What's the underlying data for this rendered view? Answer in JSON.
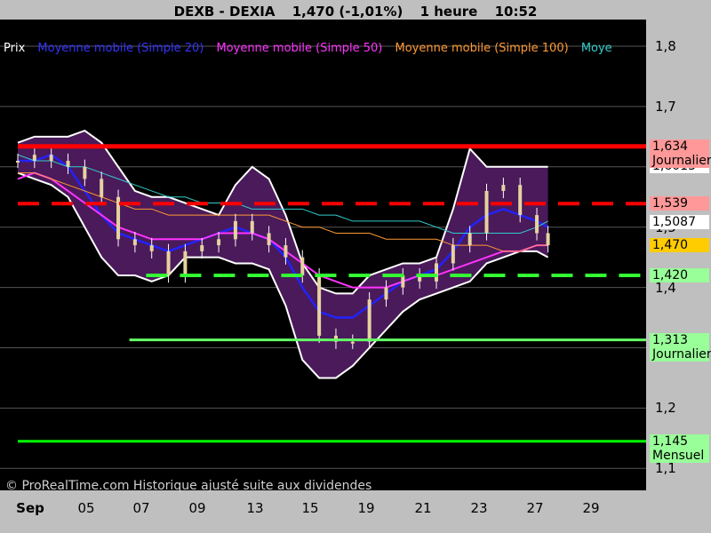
{
  "header": {
    "symbol": "DEXB - DEXIA",
    "quote": "1,470 (-1,01%)",
    "interval": "1 heure",
    "time": "10:52"
  },
  "legend": [
    {
      "label": "Prix",
      "color": "#ffffff"
    },
    {
      "label": "Moyenne mobile (Simple 20)",
      "color": "#3333ff"
    },
    {
      "label": "Moyenne mobile (Simple 50)",
      "color": "#ff33ff"
    },
    {
      "label": "Moyenne mobile (Simple 100)",
      "color": "#ff9933"
    },
    {
      "label": "Moye",
      "color": "#33cccc"
    }
  ],
  "copyright": "© ProRealTime.com Historique ajusté suite aux dividendes",
  "colors": {
    "background": "#000000",
    "band_fill": "#4a1a5a",
    "band_edge": "#ffffff",
    "ma20": "#2222ff",
    "ma50": "#ff33ff",
    "ma100": "#ff9933",
    "ma200": "#33cccc",
    "resistance": "#ff0000",
    "support": "#33ff33"
  },
  "chart_data": {
    "type": "candlestick",
    "title": "DEXB - DEXIA 1,470 (-1,01%) 1 heure 10:52",
    "x_axis": {
      "unit": "day of September",
      "ticks": [
        "Sep",
        "05",
        "07",
        "09",
        "13",
        "15",
        "19",
        "21",
        "23",
        "27",
        "29"
      ],
      "range": [
        1,
        30
      ]
    },
    "y_axis": {
      "ticks": [
        "1,8",
        "1,7",
        "1,6",
        "1,5",
        "1,4",
        "1,3",
        "1,2",
        "1,1"
      ],
      "range": [
        1.08,
        1.85
      ]
    },
    "price_series": {
      "name": "Prix",
      "x": [
        1.0,
        1.6,
        2.2,
        2.8,
        3.4,
        4.0,
        4.6,
        5.2,
        5.8,
        6.4,
        7.0,
        7.6,
        8.2,
        8.8,
        9.4,
        10.0,
        10.6,
        11.2,
        11.8,
        12.4,
        13.0,
        13.6,
        14.2,
        14.8,
        15.4,
        16.0,
        16.6,
        17.2,
        17.8,
        18.4,
        19.0,
        19.6,
        20.0
      ],
      "close": [
        1.61,
        1.62,
        1.61,
        1.6,
        1.58,
        1.55,
        1.48,
        1.47,
        1.46,
        1.42,
        1.46,
        1.47,
        1.48,
        1.51,
        1.49,
        1.47,
        1.45,
        1.42,
        1.32,
        1.31,
        1.31,
        1.38,
        1.4,
        1.42,
        1.41,
        1.44,
        1.47,
        1.49,
        1.56,
        1.57,
        1.52,
        1.49,
        1.47
      ]
    },
    "bollinger": {
      "upper": [
        1.64,
        1.65,
        1.65,
        1.65,
        1.66,
        1.64,
        1.6,
        1.56,
        1.55,
        1.55,
        1.54,
        1.53,
        1.52,
        1.57,
        1.6,
        1.58,
        1.52,
        1.44,
        1.4,
        1.39,
        1.39,
        1.42,
        1.43,
        1.44,
        1.44,
        1.45,
        1.53,
        1.63,
        1.6,
        1.6,
        1.6,
        1.6,
        1.6
      ],
      "lower": [
        1.59,
        1.58,
        1.57,
        1.55,
        1.5,
        1.45,
        1.42,
        1.42,
        1.41,
        1.42,
        1.45,
        1.45,
        1.45,
        1.44,
        1.44,
        1.43,
        1.37,
        1.28,
        1.25,
        1.25,
        1.27,
        1.3,
        1.33,
        1.36,
        1.38,
        1.39,
        1.4,
        1.41,
        1.44,
        1.45,
        1.46,
        1.46,
        1.45
      ]
    },
    "moving_averages": [
      {
        "name": "Moyenne mobile (Simple 20)",
        "values": [
          1.61,
          1.61,
          1.62,
          1.6,
          1.56,
          1.52,
          1.49,
          1.48,
          1.47,
          1.46,
          1.47,
          1.48,
          1.49,
          1.5,
          1.49,
          1.48,
          1.45,
          1.4,
          1.36,
          1.35,
          1.35,
          1.37,
          1.39,
          1.41,
          1.42,
          1.43,
          1.46,
          1.5,
          1.52,
          1.53,
          1.52,
          1.51,
          1.5
        ]
      },
      {
        "name": "Moyenne mobile (Simple 50)",
        "values": [
          1.58,
          1.59,
          1.58,
          1.56,
          1.54,
          1.52,
          1.5,
          1.49,
          1.48,
          1.48,
          1.48,
          1.48,
          1.49,
          1.49,
          1.49,
          1.48,
          1.46,
          1.44,
          1.42,
          1.41,
          1.4,
          1.4,
          1.4,
          1.41,
          1.42,
          1.42,
          1.43,
          1.44,
          1.45,
          1.46,
          1.46,
          1.47,
          1.47
        ]
      },
      {
        "name": "Moyenne mobile (Simple 100)",
        "values": [
          1.59,
          1.59,
          1.58,
          1.57,
          1.56,
          1.55,
          1.54,
          1.53,
          1.53,
          1.52,
          1.52,
          1.52,
          1.52,
          1.52,
          1.52,
          1.52,
          1.51,
          1.5,
          1.5,
          1.49,
          1.49,
          1.49,
          1.48,
          1.48,
          1.48,
          1.48,
          1.47,
          1.47,
          1.47,
          1.46,
          1.46,
          1.47,
          1.47
        ]
      },
      {
        "name": "Moye",
        "values": [
          1.62,
          1.61,
          1.61,
          1.6,
          1.6,
          1.59,
          1.58,
          1.57,
          1.56,
          1.55,
          1.55,
          1.54,
          1.54,
          1.54,
          1.53,
          1.53,
          1.53,
          1.53,
          1.52,
          1.52,
          1.51,
          1.51,
          1.51,
          1.51,
          1.51,
          1.5,
          1.49,
          1.49,
          1.49,
          1.49,
          1.49,
          1.5,
          1.51
        ]
      }
    ],
    "horizontal_lines": [
      {
        "label": "1,634",
        "sublabel": "Journalier",
        "value": 1.634,
        "style": "solid",
        "color": "#ff0000",
        "from_day": 1,
        "tag_bg": "#ff9999"
      },
      {
        "label": "1,539",
        "sublabel": "",
        "value": 1.539,
        "style": "dashed",
        "color": "#ff0000",
        "from_day": 1,
        "tag_bg": "#ff9999"
      },
      {
        "label": "1,420",
        "sublabel": "",
        "value": 1.42,
        "style": "dashed",
        "color": "#33ff33",
        "from_day": 5.6,
        "tag_bg": "#99ff99"
      },
      {
        "label": "1,313",
        "sublabel": "Journalier",
        "value": 1.313,
        "style": "solid",
        "color": "#66ff66",
        "from_day": 5.0,
        "tag_bg": "#99ff99"
      },
      {
        "label": "1,145",
        "sublabel": "Mensuel",
        "value": 1.145,
        "style": "solid",
        "color": "#00ff00",
        "from_day": 1,
        "tag_bg": "#99ff99"
      }
    ],
    "value_tags": [
      {
        "label": "1,6013",
        "value": 1.6013,
        "bg": "#ffffff"
      },
      {
        "label": "1,5087",
        "value": 1.5087,
        "bg": "#ffffff"
      },
      {
        "label": "1,470",
        "value": 1.47,
        "bg": "#ffcc00"
      }
    ]
  }
}
